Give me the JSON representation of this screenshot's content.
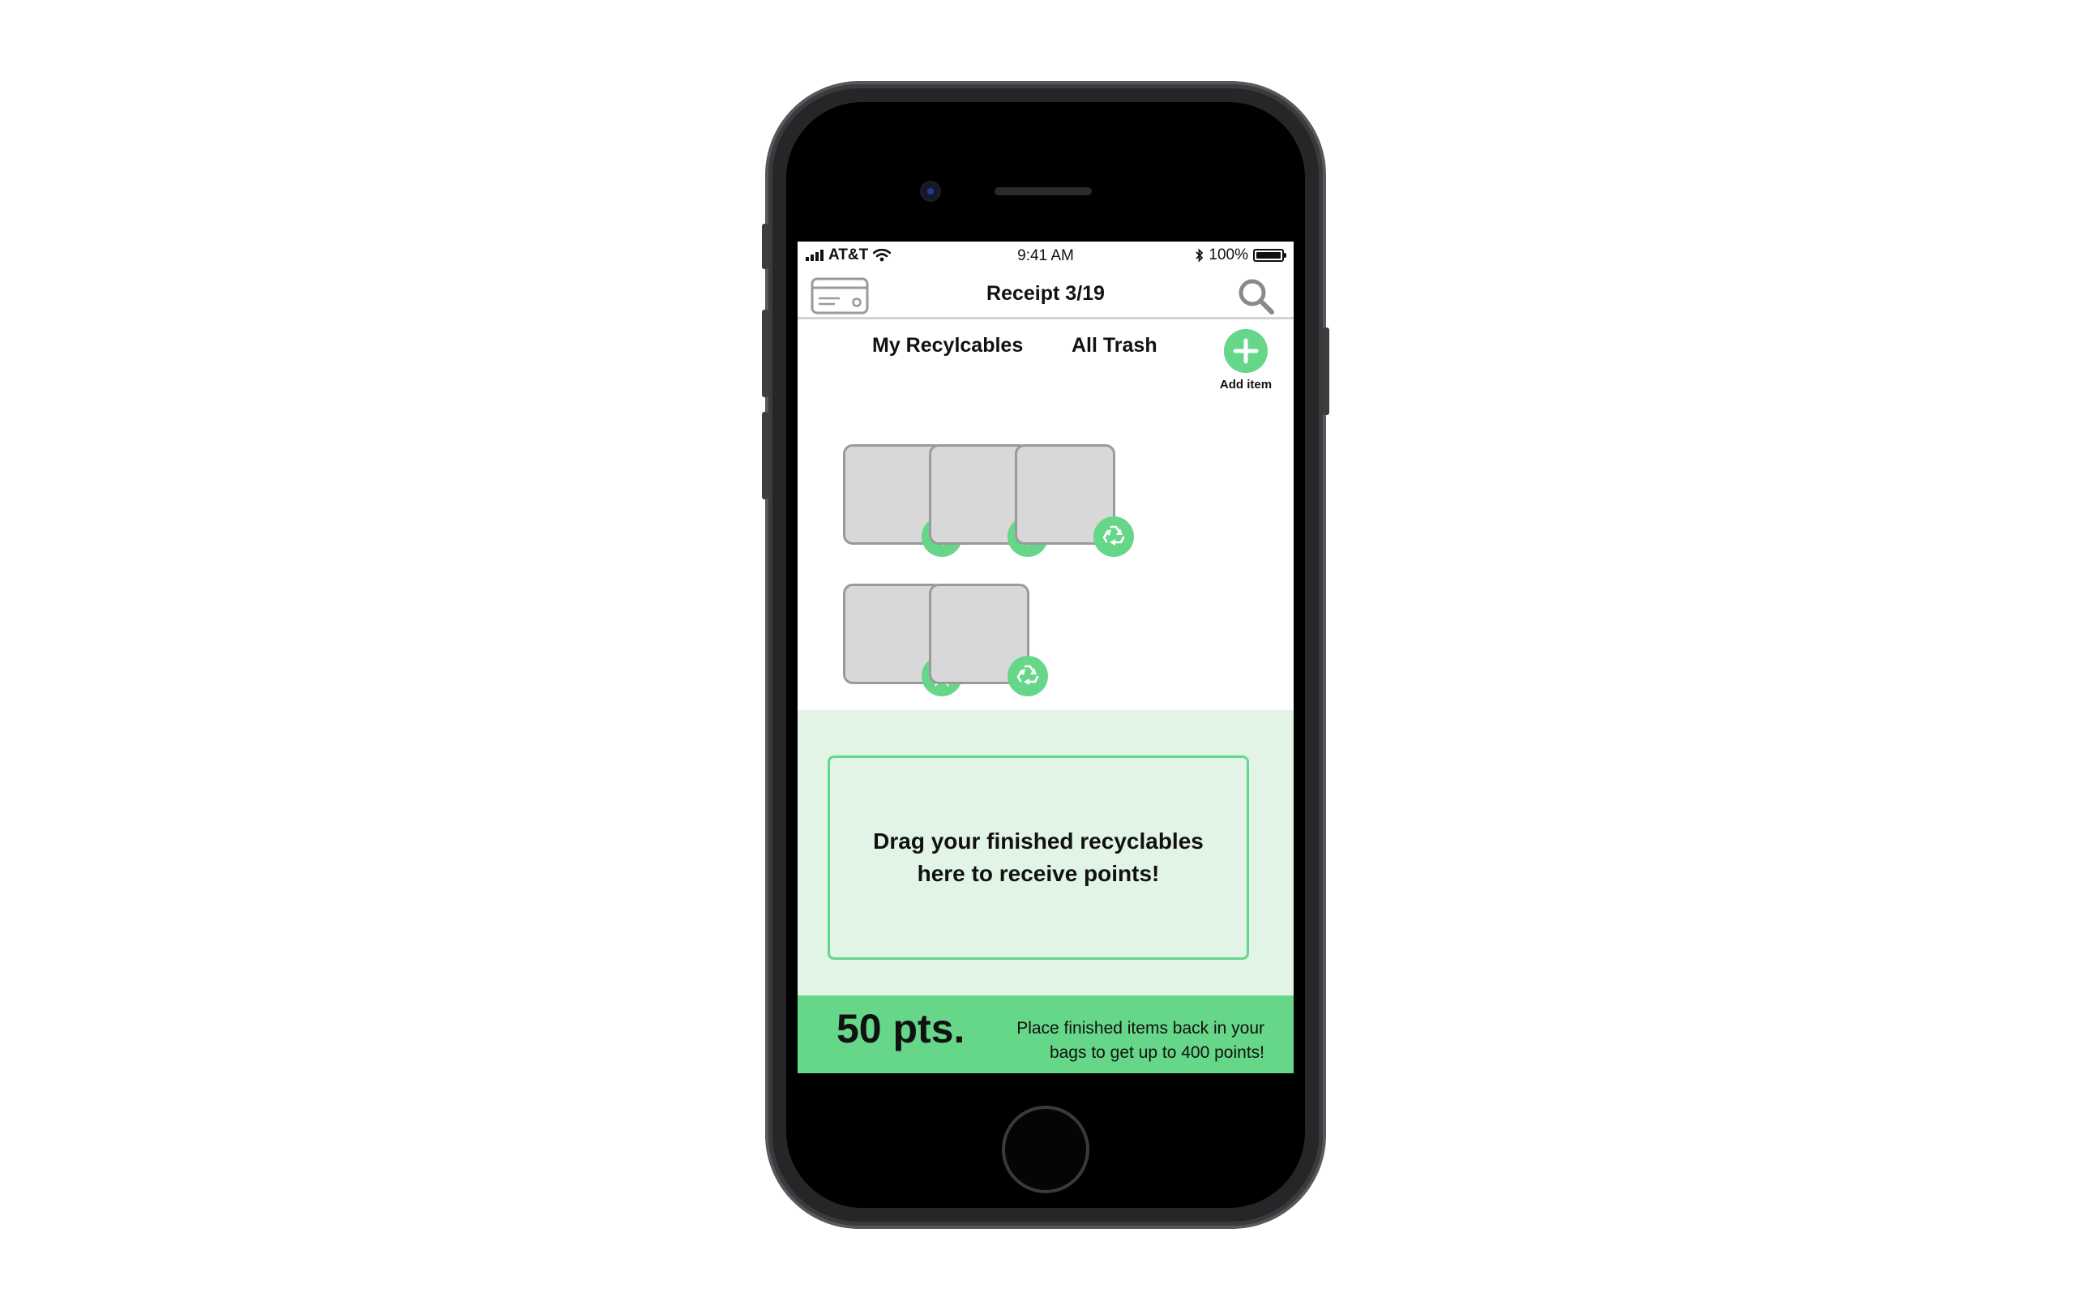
{
  "status_bar": {
    "carrier": "AT&T",
    "time": "9:41 AM",
    "battery": "100%"
  },
  "nav": {
    "title": "Receipt 3/19",
    "left_icon": "credit-card-icon",
    "right_icon": "search-icon"
  },
  "tabs": [
    {
      "label": "My Recylcables"
    },
    {
      "label": "All Trash"
    }
  ],
  "add_item": {
    "label": "Add item",
    "icon": "plus-icon"
  },
  "items": [
    {
      "badge": "recycle-icon"
    },
    {
      "badge": "recycle-icon"
    },
    {
      "badge": "recycle-icon"
    },
    {
      "badge": "star-icon"
    },
    {
      "badge": "recycle-icon"
    }
  ],
  "drop_zone": {
    "line1": "Drag your finished recyclables",
    "line2": "here to receive points!"
  },
  "points": {
    "value": "50 pts.",
    "note_line1": "Place finished items back in your",
    "note_line2": "bags to get up to 400 points!"
  },
  "colors": {
    "accent_green": "#66d689",
    "drop_background": "#e1f4e6",
    "tile_gray": "#d8d8d8"
  }
}
